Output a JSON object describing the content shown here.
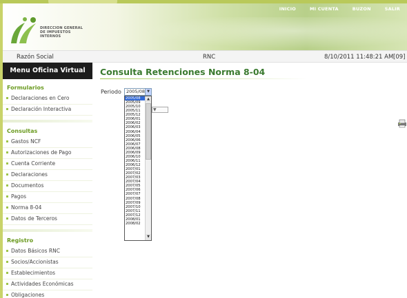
{
  "topnav": [
    "INICIO",
    "MI CUENTA",
    "BUZON",
    "SALIR"
  ],
  "logo": {
    "line1": "DIRECCION GENERAL",
    "line2": "DE IMPUESTOS",
    "line3": "INTERNOS"
  },
  "infobar": {
    "razon_social": "Razón Social",
    "rnc": "RNC",
    "datetime": "8/10/2011 11:48:21 AM",
    "extra": "[09]"
  },
  "sidebar": {
    "header": "Menu Oficina Virtual",
    "sections": [
      {
        "title": "Formularios",
        "items": [
          "Declaraciones en Cero",
          "Declaración Interactiva"
        ]
      },
      {
        "title": "Consultas",
        "items": [
          "Gastos NCF",
          "Autorizaciones de Pago",
          "Cuenta Corriente",
          "Declaraciones",
          "Documentos",
          "Pagos",
          "Norma 8-04",
          "Datos de Terceros"
        ]
      },
      {
        "title": "Registro",
        "items": [
          "Datos Básicos RNC",
          "Socios/Accionistas",
          "Establecimientos",
          "Actividades Económicas",
          "Obligaciones"
        ]
      }
    ]
  },
  "main": {
    "title": "Consulta Retenciones Norma 8-04",
    "period_label": "Periodo",
    "period_value": "2005/08",
    "period_options": [
      "2005/08",
      "2005/09",
      "2005/10",
      "2005/11",
      "2005/12",
      "2006/01",
      "2006/02",
      "2006/03",
      "2006/04",
      "2006/05",
      "2006/06",
      "2006/07",
      "2006/08",
      "2006/09",
      "2006/10",
      "2006/11",
      "2006/12",
      "2007/01",
      "2007/02",
      "2007/03",
      "2007/04",
      "2007/05",
      "2007/06",
      "2007/07",
      "2007/08",
      "2007/09",
      "2007/10",
      "2007/11",
      "2007/12",
      "2008/01",
      "2008/02"
    ]
  },
  "colors": {
    "accent": "#3a7a2f",
    "menu_green": "#6a9a1f",
    "menu_header": "#1d1d1d",
    "selected": "#3168d5"
  }
}
